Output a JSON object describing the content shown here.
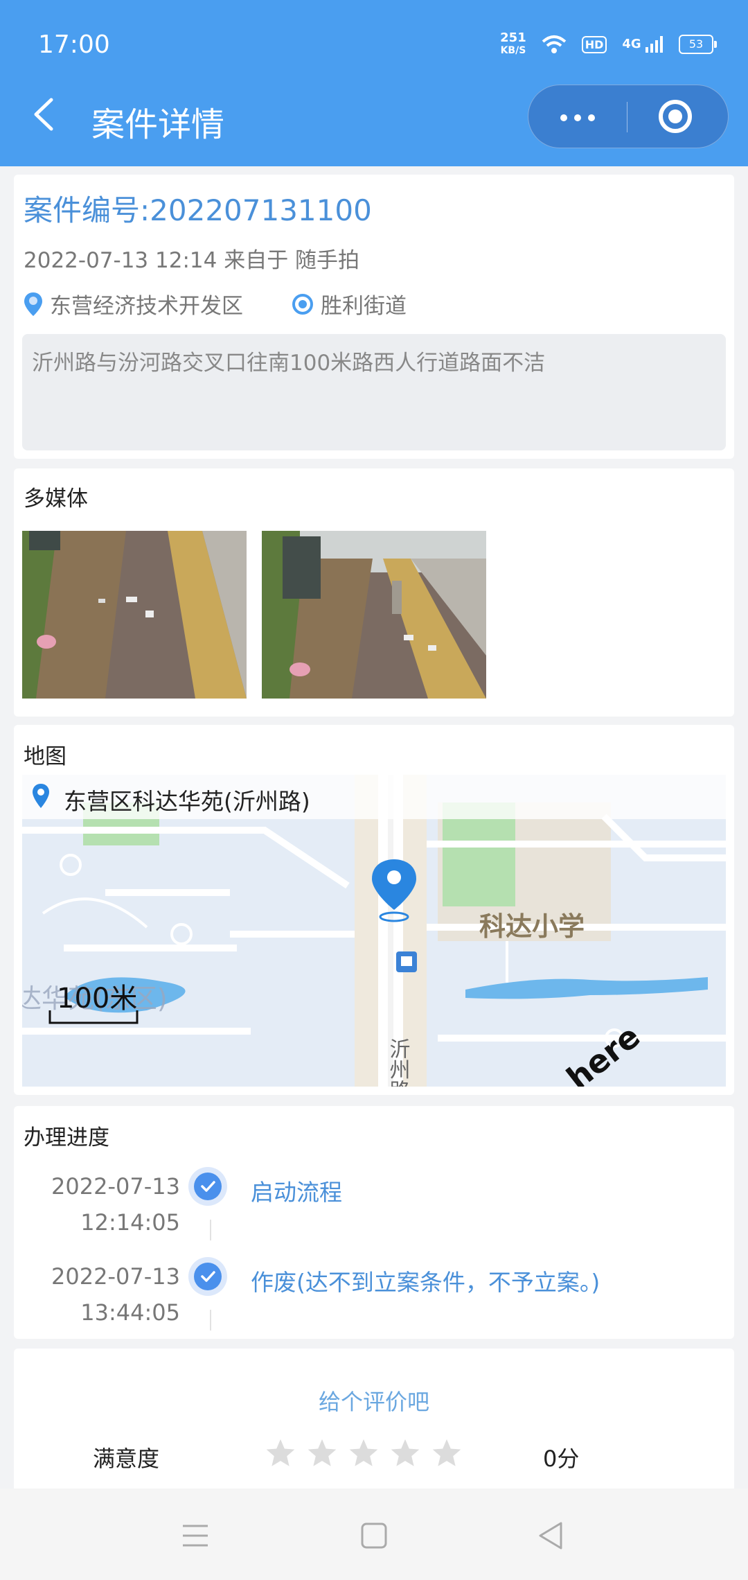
{
  "status_bar": {
    "time": "17:00",
    "net_speed_value": "251",
    "net_speed_unit": "KB/S",
    "hd_label": "HD",
    "network_label": "4G",
    "battery": "53"
  },
  "header": {
    "title": "案件详情"
  },
  "case": {
    "number": "案件编号:202207131100",
    "meta": "2022-07-13 12:14 来自于 随手拍",
    "district": "东营经济技术开发区",
    "street": "胜利街道",
    "description": "沂州路与汾河路交叉口往南100米路西人行道路面不洁"
  },
  "media": {
    "title": "多媒体"
  },
  "map": {
    "title": "地图",
    "address": "东营区科达华苑(沂州路)",
    "labels": {
      "school": "科达小学",
      "road": "沂州路",
      "area": "达华苑(东区)",
      "scale": "100米",
      "watermark": "here"
    }
  },
  "progress": {
    "title": "办理进度",
    "steps": [
      {
        "date": "2022-07-13",
        "time": "12:14:05",
        "text": "启动流程"
      },
      {
        "date": "2022-07-13",
        "time": "13:44:05",
        "text": "作废(达不到立案条件，不予立案。)"
      }
    ]
  },
  "rating": {
    "prompt": "给个评价吧",
    "label": "满意度",
    "score": "0分",
    "stars_total": 5,
    "stars_filled": 0
  },
  "colors": {
    "primary": "#4a9ef0",
    "accent_text": "#4a90d9",
    "star_empty": "#dcdcdc"
  }
}
